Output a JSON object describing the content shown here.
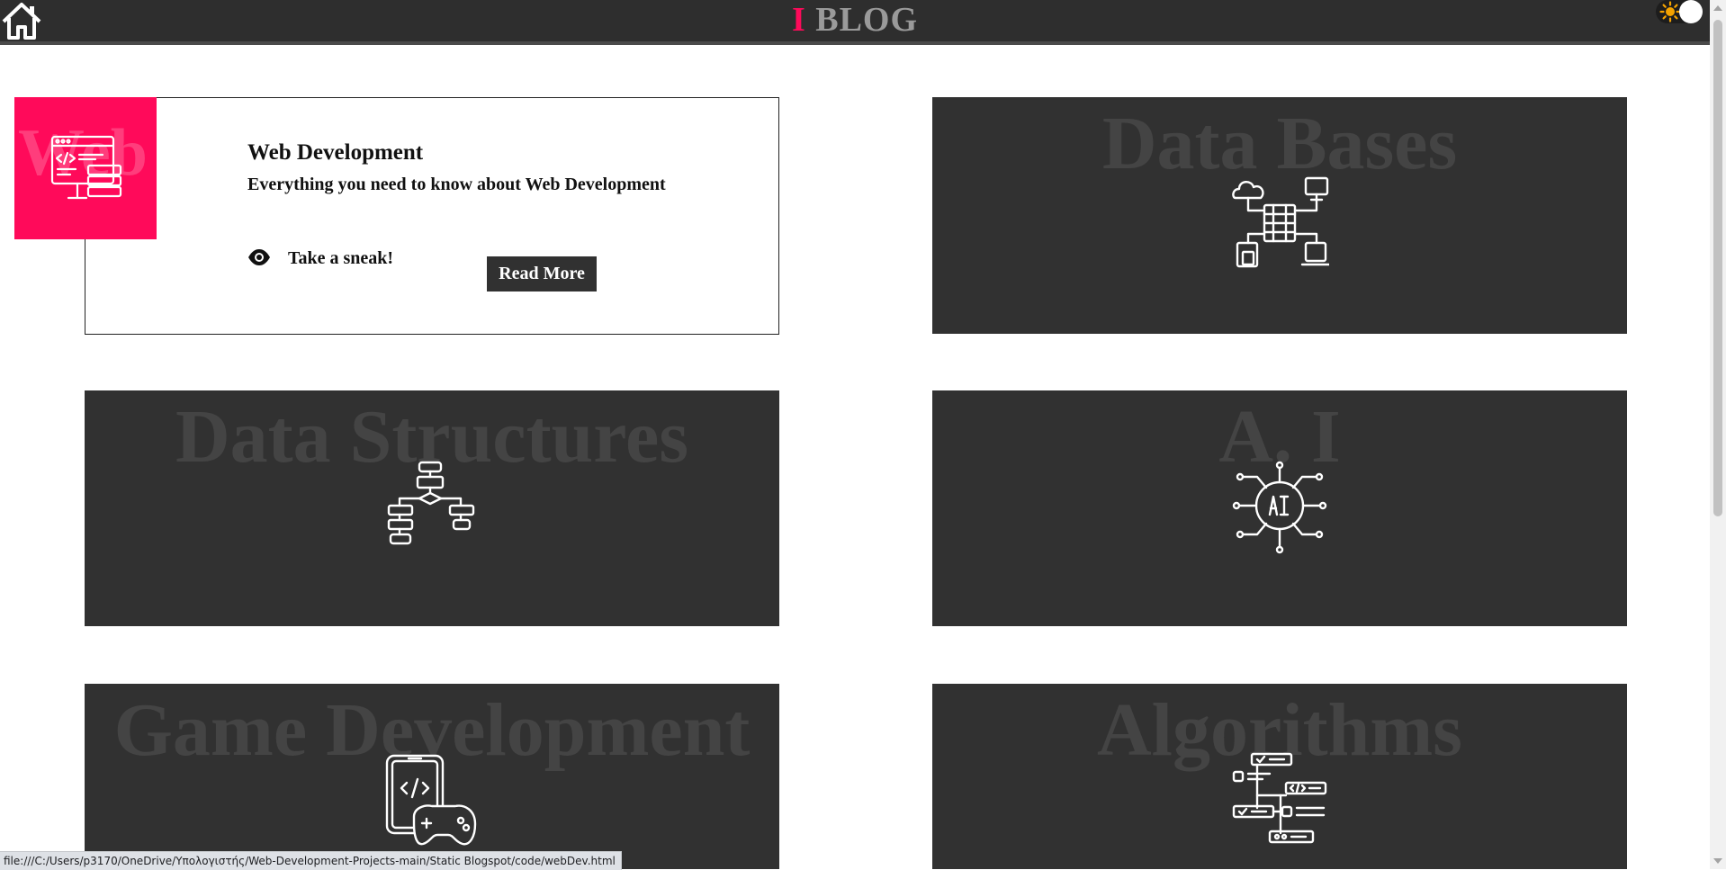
{
  "header": {
    "brand_initial": "I",
    "brand_name": "BLOG",
    "home_icon": "home-icon",
    "theme_icon": "sun-icon"
  },
  "featured_card": {
    "title": "Web Development",
    "subtitle": "Everything you need to know about Web Development",
    "ghost_text": "Web Dev",
    "sneak_label": "Take a sneak!",
    "read_more_label": "Read More",
    "icon": "code-window-icon"
  },
  "cards": [
    {
      "title": "Data Bases",
      "icon": "database-network-icon"
    },
    {
      "title": "Data Structures",
      "icon": "flowchart-icon"
    },
    {
      "title": "A. I",
      "icon": "ai-chip-icon"
    },
    {
      "title": "Game Development",
      "icon": "phone-gamepad-icon"
    },
    {
      "title": "Algorithms",
      "icon": "algorithm-steps-icon"
    }
  ],
  "status_bar": {
    "url": "file:///C:/Users/p3170/OneDrive/Υπολογιστής/Web-Development-Projects-main/Static Blogspot/code/webDev.html"
  },
  "colors": {
    "accent": "#ff0a5a",
    "card_bg": "#313131",
    "topbar_bg": "#2e2e2e"
  }
}
